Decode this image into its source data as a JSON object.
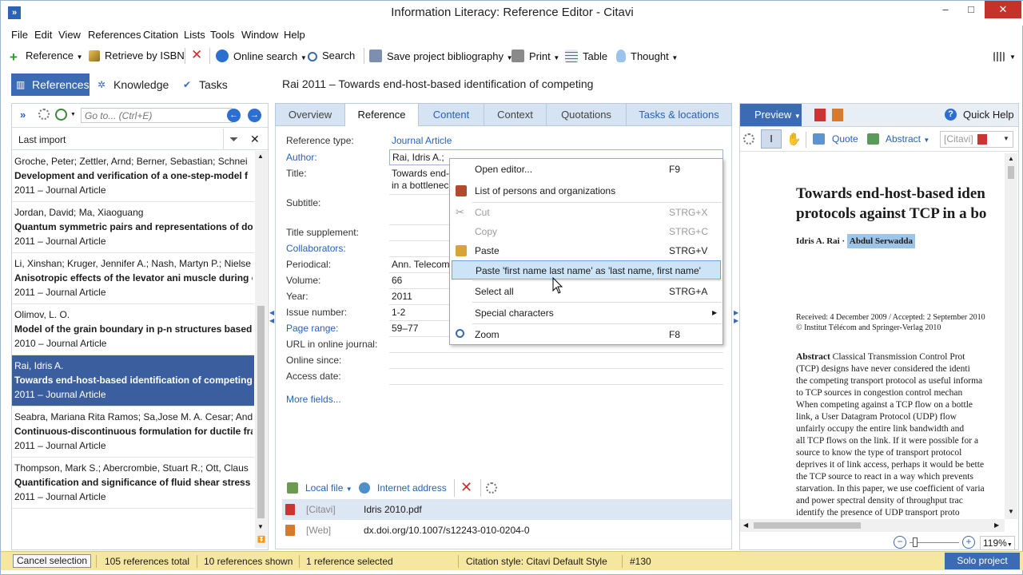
{
  "window": {
    "title": "Information Literacy: Reference Editor - Citavi",
    "app_icon": "»"
  },
  "menu": [
    "File",
    "Edit",
    "View",
    "References",
    "Citation",
    "Lists",
    "Tools",
    "Window",
    "Help"
  ],
  "toolbar": {
    "reference": "Reference",
    "retrieve_isbn": "Retrieve by ISBN",
    "online_search": "Online search",
    "search": "Search",
    "save_bibliography": "Save project bibliography",
    "print": "Print",
    "table": "Table",
    "thought": "Thought"
  },
  "nav": {
    "references": "References",
    "knowledge": "Knowledge",
    "tasks": "Tasks"
  },
  "doc_title": "Rai 2011 – Towards end-host-based identification of competing",
  "left": {
    "goto_placeholder": "Go to... (Ctrl+E)",
    "filter_label": "Last import",
    "items": [
      {
        "authors": "Groche, Peter; Zettler, Arnd; Berner, Sebastian; Schnei",
        "title": "Development and verification of a one-step-model f",
        "meta": "2011 – Journal Article"
      },
      {
        "authors": "Jordan, David; Ma, Xiaoguang",
        "title": "Quantum symmetric pairs and representations of dou",
        "meta": "2011 – Journal Article"
      },
      {
        "authors": "Li, Xinshan; Kruger, Jennifer A.; Nash, Martyn P.; Nielse",
        "title": "Anisotropic effects of the levator ani muscle during c",
        "meta": "2011 – Journal Article"
      },
      {
        "authors": "Olimov, L. O.",
        "title": "Model of the grain boundary in p-n structures based",
        "meta": "2010 – Journal Article"
      },
      {
        "authors": "Rai, Idris A.",
        "title": "Towards end-host-based identification of competing",
        "meta": "2011 – Journal Article"
      },
      {
        "authors": "Seabra, Mariana Rita Ramos; Sa,Jose M. A. Cesar; Andr",
        "title": "Continuous-discontinuous formulation for ductile fra",
        "meta": "2011 – Journal Article"
      },
      {
        "authors": "Thompson, Mark S.; Abercrombie, Stuart R.; Ott, Claus",
        "title": "Quantification and significance of fluid shear stress fi",
        "meta": "2011 – Journal Article"
      }
    ]
  },
  "tabs": [
    "Overview",
    "Reference",
    "Content",
    "Context",
    "Quotations",
    "Tasks & locations"
  ],
  "fields": {
    "reference_type_label": "Reference type:",
    "reference_type": "Journal Article",
    "author_label": "Author:",
    "author": "Rai, Idris A.;",
    "title_label": "Title:",
    "title_1": "Towards end-",
    "title_2": "in a bottlenec",
    "subtitle_label": "Subtitle:",
    "title_supplement_label": "Title supplement:",
    "collaborators_label": "Collaborators:",
    "periodical_label": "Periodical:",
    "periodical": "Ann. Telecom",
    "volume_label": "Volume:",
    "volume": "66",
    "year_label": "Year:",
    "year": "2011",
    "issue_label": "Issue number:",
    "issue": "1-2",
    "page_range_label": "Page range:",
    "page_range": "59–77",
    "url_label": "URL in online journal:",
    "online_since_label": "Online since:",
    "access_date_label": "Access date:",
    "more_fields": "More fields..."
  },
  "attachments": {
    "local_file": "Local file",
    "internet_address": "Internet address",
    "rows": [
      {
        "tag": "[Citavi]",
        "name": "Idris 2010.pdf"
      },
      {
        "tag": "[Web]",
        "name": "dx.doi.org/10.1007/s12243-010-0204-0"
      }
    ]
  },
  "context_menu": [
    {
      "label": "Open editor...",
      "key": "F9"
    },
    {
      "label": "List of persons and organizations",
      "key": ""
    },
    {
      "label": "Cut",
      "key": "STRG+X"
    },
    {
      "label": "Copy",
      "key": "STRG+C"
    },
    {
      "label": "Paste",
      "key": "STRG+V"
    },
    {
      "label": "Paste 'first name last name' as 'last name, first name'",
      "key": ""
    },
    {
      "label": "Select all",
      "key": "STRG+A"
    },
    {
      "label": "Special characters",
      "key": ""
    },
    {
      "label": "Zoom",
      "key": "F8"
    }
  ],
  "right": {
    "preview": "Preview",
    "quick_help": "Quick Help",
    "quote": "Quote",
    "abstract": "Abstract",
    "citavi_select": "[Citavi]",
    "zoom": "119%",
    "pdf": {
      "title_1": "Towards end-host-based iden",
      "title_2": "protocols against TCP in a bo",
      "author_1": "Idris A. Rai ·",
      "author_2": "Abdul Serwadda",
      "received": "Received: 4 December 2009 / Accepted: 2 September 2010",
      "copyright": "© Institut Télécom and Springer-Verlag 2010",
      "abstract_head": "Abstract",
      "abstract_lines": [
        " Classical Transmission Control Prot",
        "(TCP) designs have never considered the identi",
        "the competing transport protocol as useful informa",
        "to TCP sources in congestion control mechan",
        "When competing against a TCP flow on a bottle",
        "link, a User Datagram Protocol (UDP) flow",
        "unfairly occupy the entire link bandwidth and",
        "all TCP flows on the link. If it were possible for a",
        "source to know the type of transport protocol",
        "deprives it of link access, perhaps it would be bette",
        "the TCP source to react in a way which prevents",
        "starvation. In this paper, we use coefficient of varia",
        "and power spectral density of throughput trac",
        "identify the presence of UDP transport proto"
      ]
    }
  },
  "status": {
    "cancel_selection": "Cancel selection",
    "total": "105 references total",
    "shown": "10 references shown",
    "selected": "1 reference selected",
    "style": "Citation style: Citavi Default Style",
    "number": "#130",
    "solo": "Solo project"
  },
  "colors": {
    "accent": "#3b6bb2",
    "link": "#2762b9",
    "status_bg": "#f5e6a0",
    "selection": "#3b5f9e"
  }
}
